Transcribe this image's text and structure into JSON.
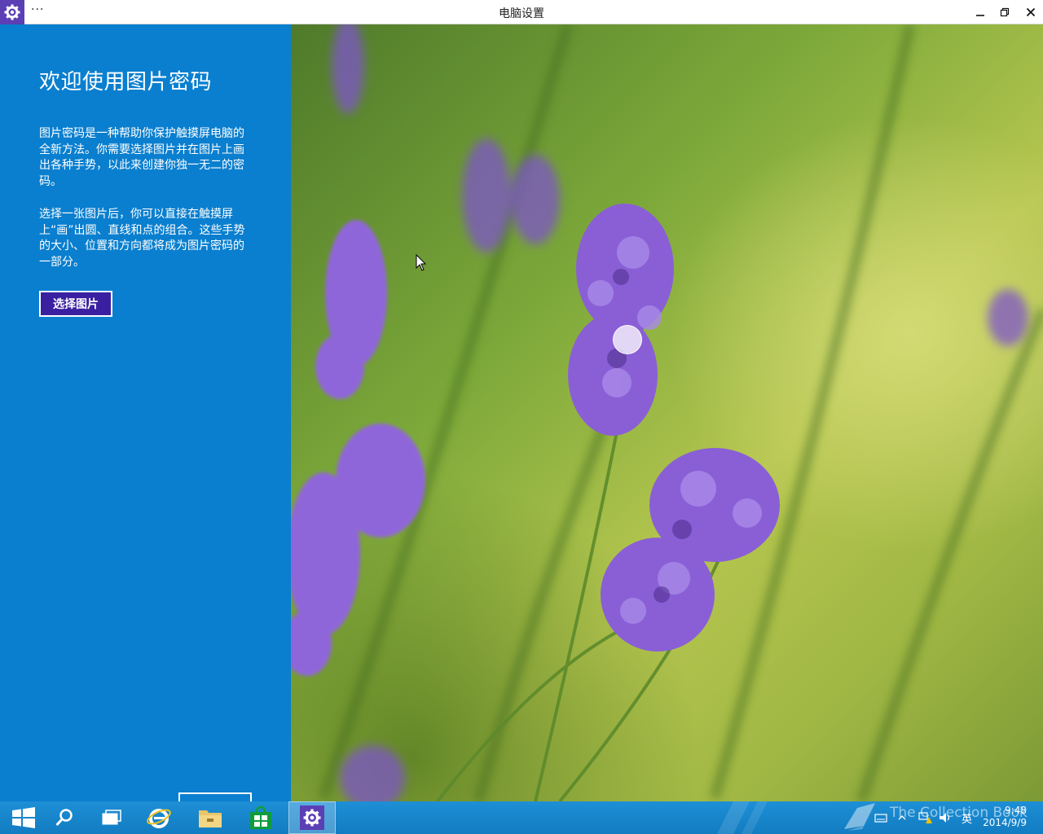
{
  "window": {
    "title": "电脑设置",
    "more_label": "···"
  },
  "panel": {
    "title": "欢迎使用图片密码",
    "paragraph1": "图片密码是一种帮助你保护触摸屏电脑的全新方法。你需要选择图片并在图片上画出各种手势，以此来创建你独一无二的密码。",
    "paragraph2": "选择一张图片后，你可以直接在触摸屏上“画”出圆、直线和点的组合。这些手势的大小、位置和方向都将成为图片密码的一部分。",
    "choose_button": "选择图片"
  },
  "tray": {
    "input_language": "英",
    "time": "9:48",
    "date": "2014/9/9",
    "watermark": "The Collection Book"
  },
  "colors": {
    "panel": "#0a7fcf",
    "button": "#3a1fa0",
    "taskbar": "#1e8fd6",
    "app_icon": "#5b3fb5"
  }
}
